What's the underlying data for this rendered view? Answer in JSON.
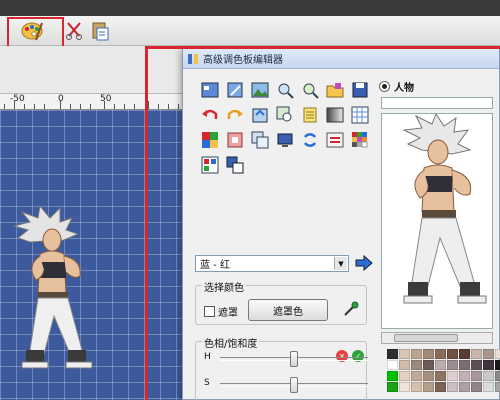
{
  "dialog": {
    "title": "高级调色板编辑器",
    "radio_label": "人物",
    "palette_combo_value": "蓝 - 红",
    "select_color": {
      "group_label": "选择颜色",
      "mask_checkbox_label": "遮罩",
      "mask_color_button": "遮罩色"
    },
    "hue_saturation": {
      "group_label": "色相/饱和度",
      "hue_label": "H",
      "sat_label": "S",
      "hue_value": 0.5,
      "sat_value": 0.5
    }
  },
  "ruler": {
    "labels": [
      "-50",
      "0",
      "50"
    ]
  },
  "colors": {
    "highlight_red": "#d8262e",
    "canvas_blue": "#3d5a9c"
  },
  "palette_swatches": [
    "#2e2e2e",
    "#d8c6b0",
    "#b9a590",
    "#a08976",
    "#8b6a5a",
    "#704f45",
    "#5a3b35",
    "#c8b7a8",
    "#a9968a",
    "#e8e0d6",
    "#ffffff",
    "#d1bca8",
    "#9b8a7c",
    "#6a5c55",
    "#bfaeb0",
    "#9d8c8f",
    "#7d6d72",
    "#5e4f56",
    "#3e3540",
    "#1a1a1a",
    "#00c000",
    "#e3d2c2",
    "#c2a995",
    "#a78f7d",
    "#8d7465",
    "#e0cfd1",
    "#c3b1b5",
    "#a8969b",
    "#c9c9c9",
    "#8a8a8a",
    "#16a516",
    "#f0e4d8",
    "#d6c1ad",
    "#b39e8b",
    "#7b6556",
    "#cdbec2",
    "#b0a0a6",
    "#938389",
    "#dcdcdc",
    "#a5a5a5"
  ]
}
